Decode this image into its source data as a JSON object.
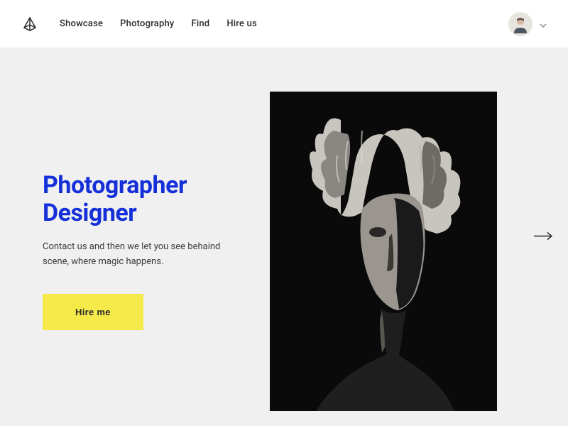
{
  "nav": {
    "items": [
      {
        "label": "Showcase"
      },
      {
        "label": "Photography"
      },
      {
        "label": "Find"
      },
      {
        "label": "Hire us"
      }
    ]
  },
  "hero": {
    "title_line1": "Photographer",
    "title_line2": "Designer",
    "subtitle": "Contact us and then we let you see behaind scene, where magic happens.",
    "button_label": "Hire me"
  },
  "colors": {
    "accent": "#1530d8",
    "cta": "#f6e94a",
    "background": "#f0f0f0"
  }
}
